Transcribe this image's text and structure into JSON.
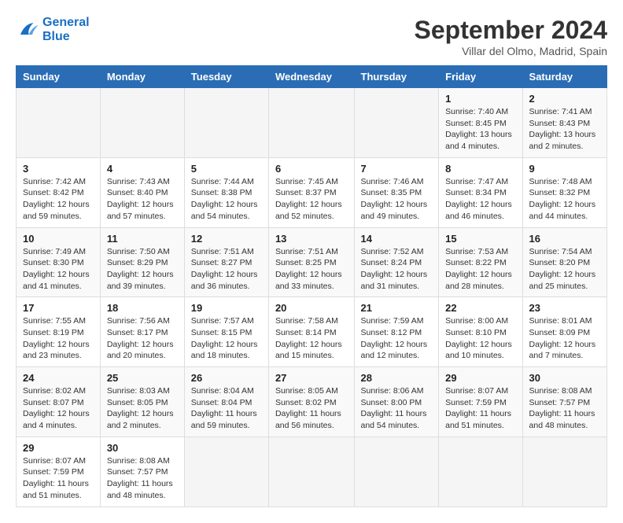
{
  "header": {
    "logo_line1": "General",
    "logo_line2": "Blue",
    "title": "September 2024",
    "subtitle": "Villar del Olmo, Madrid, Spain"
  },
  "calendar": {
    "days_of_week": [
      "Sunday",
      "Monday",
      "Tuesday",
      "Wednesday",
      "Thursday",
      "Friday",
      "Saturday"
    ],
    "weeks": [
      [
        null,
        null,
        null,
        null,
        null,
        null,
        {
          "day": "1",
          "sunrise": "Sunrise: 7:40 AM",
          "sunset": "Sunset: 8:45 PM",
          "daylight": "Daylight: 13 hours and 4 minutes."
        },
        {
          "day": "2",
          "sunrise": "Sunrise: 7:41 AM",
          "sunset": "Sunset: 8:43 PM",
          "daylight": "Daylight: 13 hours and 2 minutes."
        }
      ],
      [
        null,
        {
          "day": "1",
          "sunrise": "Sunrise: 7:40 AM",
          "sunset": "Sunset: 8:45 PM",
          "daylight": "Daylight: 13 hours and 4 minutes."
        },
        {
          "day": "2",
          "sunrise": "Sunrise: 7:41 AM",
          "sunset": "Sunset: 8:43 PM",
          "daylight": "Daylight: 13 hours and 2 minutes."
        },
        {
          "day": "3",
          "sunrise": "Sunrise: 7:42 AM",
          "sunset": "Sunset: 8:42 PM",
          "daylight": "Daylight: 12 hours and 59 minutes."
        },
        {
          "day": "4",
          "sunrise": "Sunrise: 7:43 AM",
          "sunset": "Sunset: 8:40 PM",
          "daylight": "Daylight: 12 hours and 57 minutes."
        },
        {
          "day": "5",
          "sunrise": "Sunrise: 7:44 AM",
          "sunset": "Sunset: 8:38 PM",
          "daylight": "Daylight: 12 hours and 54 minutes."
        },
        {
          "day": "6",
          "sunrise": "Sunrise: 7:45 AM",
          "sunset": "Sunset: 8:37 PM",
          "daylight": "Daylight: 12 hours and 52 minutes."
        },
        {
          "day": "7",
          "sunrise": "Sunrise: 7:46 AM",
          "sunset": "Sunset: 8:35 PM",
          "daylight": "Daylight: 12 hours and 49 minutes."
        }
      ],
      [
        {
          "day": "8",
          "sunrise": "Sunrise: 7:47 AM",
          "sunset": "Sunset: 8:34 PM",
          "daylight": "Daylight: 12 hours and 46 minutes."
        },
        {
          "day": "9",
          "sunrise": "Sunrise: 7:48 AM",
          "sunset": "Sunset: 8:32 PM",
          "daylight": "Daylight: 12 hours and 44 minutes."
        },
        {
          "day": "10",
          "sunrise": "Sunrise: 7:49 AM",
          "sunset": "Sunset: 8:30 PM",
          "daylight": "Daylight: 12 hours and 41 minutes."
        },
        {
          "day": "11",
          "sunrise": "Sunrise: 7:50 AM",
          "sunset": "Sunset: 8:29 PM",
          "daylight": "Daylight: 12 hours and 39 minutes."
        },
        {
          "day": "12",
          "sunrise": "Sunrise: 7:51 AM",
          "sunset": "Sunset: 8:27 PM",
          "daylight": "Daylight: 12 hours and 36 minutes."
        },
        {
          "day": "13",
          "sunrise": "Sunrise: 7:51 AM",
          "sunset": "Sunset: 8:25 PM",
          "daylight": "Daylight: 12 hours and 33 minutes."
        },
        {
          "day": "14",
          "sunrise": "Sunrise: 7:52 AM",
          "sunset": "Sunset: 8:24 PM",
          "daylight": "Daylight: 12 hours and 31 minutes."
        }
      ],
      [
        {
          "day": "15",
          "sunrise": "Sunrise: 7:53 AM",
          "sunset": "Sunset: 8:22 PM",
          "daylight": "Daylight: 12 hours and 28 minutes."
        },
        {
          "day": "16",
          "sunrise": "Sunrise: 7:54 AM",
          "sunset": "Sunset: 8:20 PM",
          "daylight": "Daylight: 12 hours and 25 minutes."
        },
        {
          "day": "17",
          "sunrise": "Sunrise: 7:55 AM",
          "sunset": "Sunset: 8:19 PM",
          "daylight": "Daylight: 12 hours and 23 minutes."
        },
        {
          "day": "18",
          "sunrise": "Sunrise: 7:56 AM",
          "sunset": "Sunset: 8:17 PM",
          "daylight": "Daylight: 12 hours and 20 minutes."
        },
        {
          "day": "19",
          "sunrise": "Sunrise: 7:57 AM",
          "sunset": "Sunset: 8:15 PM",
          "daylight": "Daylight: 12 hours and 18 minutes."
        },
        {
          "day": "20",
          "sunrise": "Sunrise: 7:58 AM",
          "sunset": "Sunset: 8:14 PM",
          "daylight": "Daylight: 12 hours and 15 minutes."
        },
        {
          "day": "21",
          "sunrise": "Sunrise: 7:59 AM",
          "sunset": "Sunset: 8:12 PM",
          "daylight": "Daylight: 12 hours and 12 minutes."
        }
      ],
      [
        {
          "day": "22",
          "sunrise": "Sunrise: 8:00 AM",
          "sunset": "Sunset: 8:10 PM",
          "daylight": "Daylight: 12 hours and 10 minutes."
        },
        {
          "day": "23",
          "sunrise": "Sunrise: 8:01 AM",
          "sunset": "Sunset: 8:09 PM",
          "daylight": "Daylight: 12 hours and 7 minutes."
        },
        {
          "day": "24",
          "sunrise": "Sunrise: 8:02 AM",
          "sunset": "Sunset: 8:07 PM",
          "daylight": "Daylight: 12 hours and 4 minutes."
        },
        {
          "day": "25",
          "sunrise": "Sunrise: 8:03 AM",
          "sunset": "Sunset: 8:05 PM",
          "daylight": "Daylight: 12 hours and 2 minutes."
        },
        {
          "day": "26",
          "sunrise": "Sunrise: 8:04 AM",
          "sunset": "Sunset: 8:04 PM",
          "daylight": "Daylight: 11 hours and 59 minutes."
        },
        {
          "day": "27",
          "sunrise": "Sunrise: 8:05 AM",
          "sunset": "Sunset: 8:02 PM",
          "daylight": "Daylight: 11 hours and 56 minutes."
        },
        {
          "day": "28",
          "sunrise": "Sunrise: 8:06 AM",
          "sunset": "Sunset: 8:00 PM",
          "daylight": "Daylight: 11 hours and 54 minutes."
        }
      ],
      [
        {
          "day": "29",
          "sunrise": "Sunrise: 8:07 AM",
          "sunset": "Sunset: 7:59 PM",
          "daylight": "Daylight: 11 hours and 51 minutes."
        },
        {
          "day": "30",
          "sunrise": "Sunrise: 8:08 AM",
          "sunset": "Sunset: 7:57 PM",
          "daylight": "Daylight: 11 hours and 48 minutes."
        },
        null,
        null,
        null,
        null,
        null
      ]
    ],
    "week_data": [
      {
        "cells": [
          {
            "day": "",
            "empty": true
          },
          {
            "day": "",
            "empty": true
          },
          {
            "day": "",
            "empty": true
          },
          {
            "day": "",
            "empty": true
          },
          {
            "day": "",
            "empty": true
          },
          {
            "day": "1",
            "sunrise": "Sunrise: 7:40 AM",
            "sunset": "Sunset: 8:45 PM",
            "daylight": "Daylight: 13 hours\nand 4 minutes."
          },
          {
            "day": "2",
            "sunrise": "Sunrise: 7:41 AM",
            "sunset": "Sunset: 8:43 PM",
            "daylight": "Daylight: 13 hours\nand 2 minutes."
          }
        ]
      }
    ]
  }
}
